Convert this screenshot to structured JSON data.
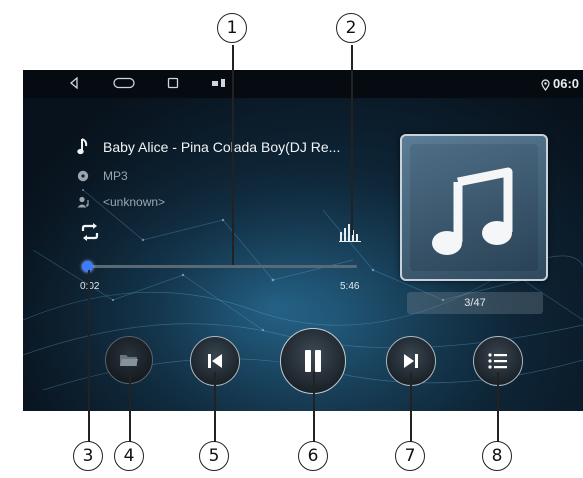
{
  "status_bar": {
    "time": "06:0",
    "icons": [
      "back-icon",
      "home-icon",
      "recents-icon",
      "screenshot-icon",
      "location-icon"
    ]
  },
  "track": {
    "title": "Baby Alice - Pina Colada Boy(DJ Re...",
    "format": "MP3",
    "artist": "<unknown>"
  },
  "playback": {
    "elapsed": "0:02",
    "duration": "5:46",
    "progress_fraction": 0.006,
    "track_counter": "3/47",
    "mode_icon": "repeat-icon",
    "equalizer_icon": "equalizer-icon"
  },
  "controls": [
    "folder-icon",
    "previous-icon",
    "pause-icon",
    "next-icon",
    "playlist-icon"
  ],
  "callouts": [
    "1",
    "2",
    "3",
    "4",
    "5",
    "6",
    "7",
    "8"
  ],
  "colors": {
    "background": "#0b1a26",
    "accent": "#3d7bff",
    "button_border": "#aeb8c0"
  }
}
